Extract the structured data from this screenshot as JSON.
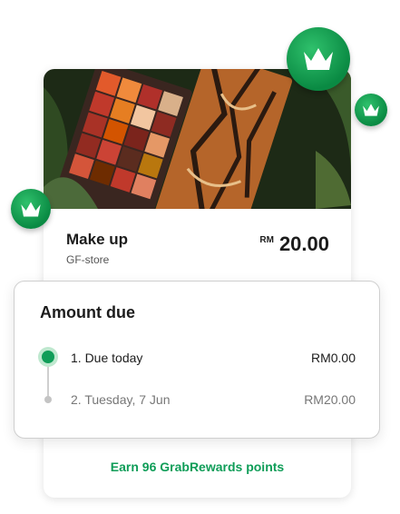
{
  "product": {
    "title": "Make up",
    "store": "GF-store",
    "currency": "RM",
    "price": "20.00"
  },
  "amount_due": {
    "heading": "Amount due",
    "rows": [
      {
        "label": "1. Due today",
        "value": "RM0.00",
        "active": true
      },
      {
        "label": "2. Tuesday, 7 Jun",
        "value": "RM20.00",
        "active": false
      }
    ]
  },
  "rewards": {
    "text": "Earn 96 GrabRewards points"
  },
  "colors": {
    "accent_green": "#0f9d58",
    "badge_green": "#1aa456"
  },
  "icons": [
    "crown-badge-icon"
  ]
}
